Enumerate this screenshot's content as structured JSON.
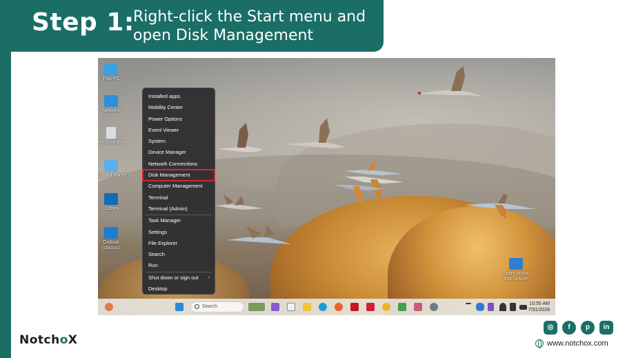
{
  "header": {
    "step": "Step 1:",
    "line1": "Right-click the Start menu and",
    "line2": "open Disk Management"
  },
  "desktop": {
    "icons": [
      {
        "label": "This PC",
        "icon": "monitor-icon",
        "color": "#3aa0e0"
      },
      {
        "label": "Network",
        "icon": "network-icon",
        "color": "#2f8fd8"
      },
      {
        "label": "Recycle Bin",
        "icon": "recycle-bin-icon",
        "color": "#d8dde2"
      },
      {
        "label": "Control Panel",
        "icon": "control-panel-icon",
        "color": "#5ab0e8"
      },
      {
        "label": "Outlook",
        "icon": "outlook-icon",
        "color": "#0f6cbd"
      },
      {
        "label": "Outlook (classic)",
        "icon": "outlook-classic-icon",
        "color": "#1a7fd1"
      }
    ],
    "learn_icon": {
      "label": "Learn about this picture",
      "icon": "learn-about-picture-icon",
      "color": "#2d7fd3"
    }
  },
  "context_menu": {
    "items": [
      {
        "label": "Installed apps"
      },
      {
        "label": "Mobility Center"
      },
      {
        "label": "Power Options"
      },
      {
        "label": "Event Viewer"
      },
      {
        "label": "System"
      },
      {
        "label": "Device Manager"
      },
      {
        "label": "Network Connections"
      },
      {
        "label": "Disk Management",
        "highlighted": true
      },
      {
        "label": "Computer Management"
      },
      {
        "label": "Terminal"
      },
      {
        "label": "Terminal (Admin)"
      },
      {
        "label": "Task Manager"
      },
      {
        "label": "Settings"
      },
      {
        "label": "File Explorer"
      },
      {
        "label": "Search"
      },
      {
        "label": "Run"
      },
      {
        "label": "Shut down or sign out",
        "submenu": true
      },
      {
        "label": "Desktop"
      }
    ],
    "highlight_color": "#d9252c"
  },
  "taskbar": {
    "search_placeholder": "Search",
    "clock_time": "10:55 AM",
    "clock_date": "7/31/2026"
  },
  "footer": {
    "brand_a": "Notch",
    "brand_b": "o",
    "brand_c": "X",
    "website": "www.notchox.com",
    "socials": [
      "instagram-icon",
      "facebook-icon",
      "pinterest-icon",
      "linkedin-icon"
    ],
    "brand_color": "#1a6e66"
  }
}
